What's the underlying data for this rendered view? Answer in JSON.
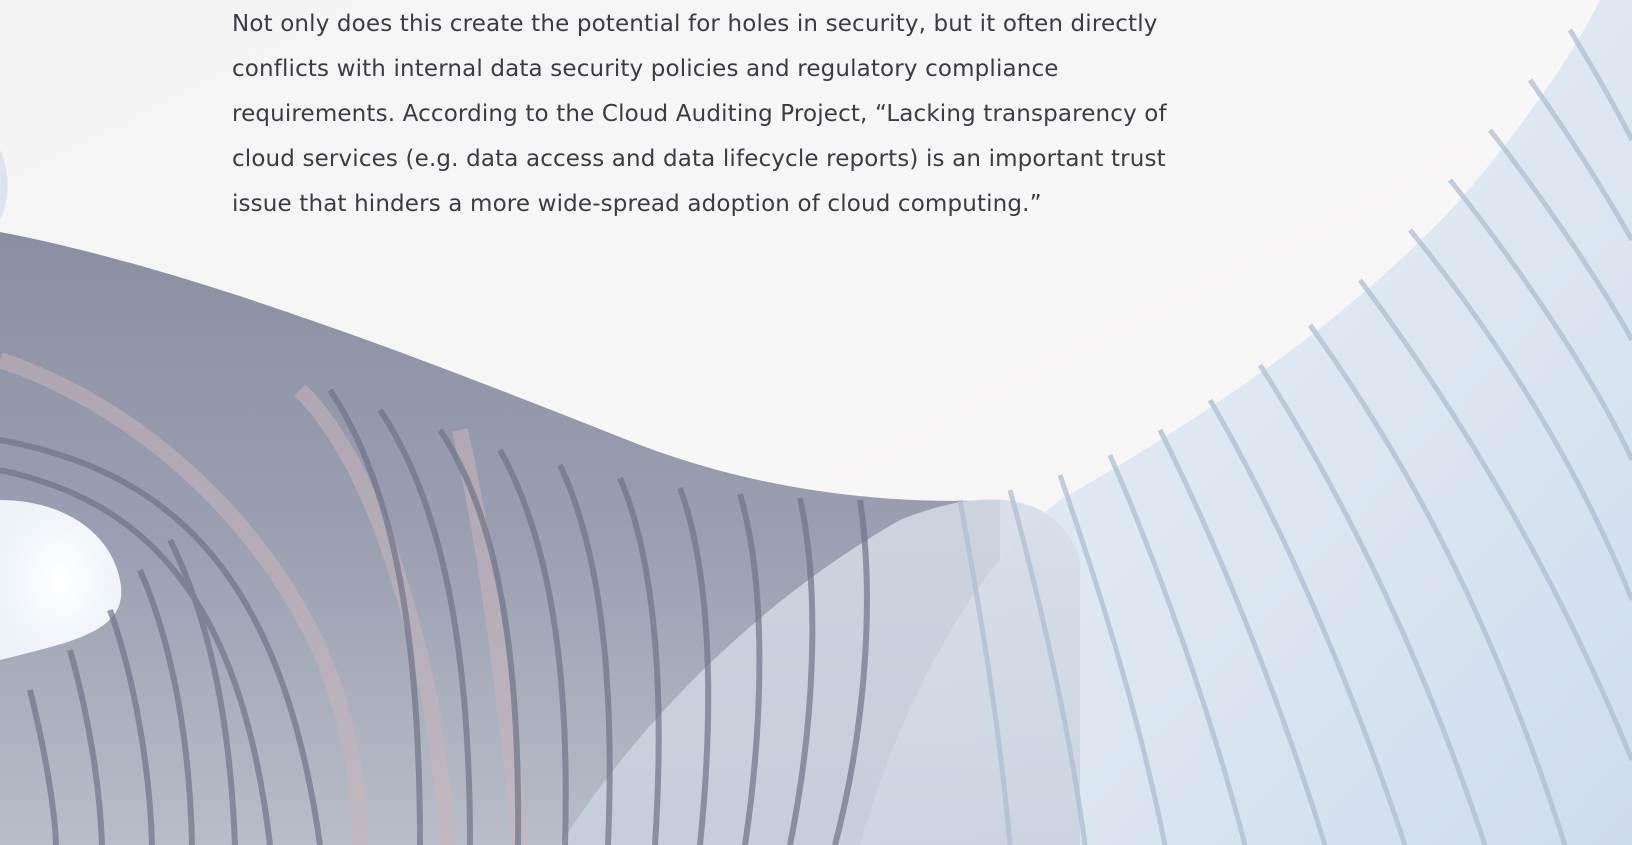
{
  "article": {
    "paragraph": "Not only does this create the potential for holes in security, but it often directly conflicts with internal data security policies and regulatory compliance requirements. According to the Cloud Auditing Project, “Lacking transparency of cloud services (e.g. data access and data lifecycle reports) is an important trust issue that hinders a more wide-spread adoption of cloud computing.”"
  },
  "colors": {
    "page_background": "#f7f6f6",
    "body_text": "#3a3c43",
    "ribbon_light": "#e3ecf4",
    "ribbon_shadow": "#7c8295",
    "ribbon_pink": "#c7b2b6"
  },
  "decoration": {
    "hero_image": "abstract-ribbon-sculpture"
  }
}
